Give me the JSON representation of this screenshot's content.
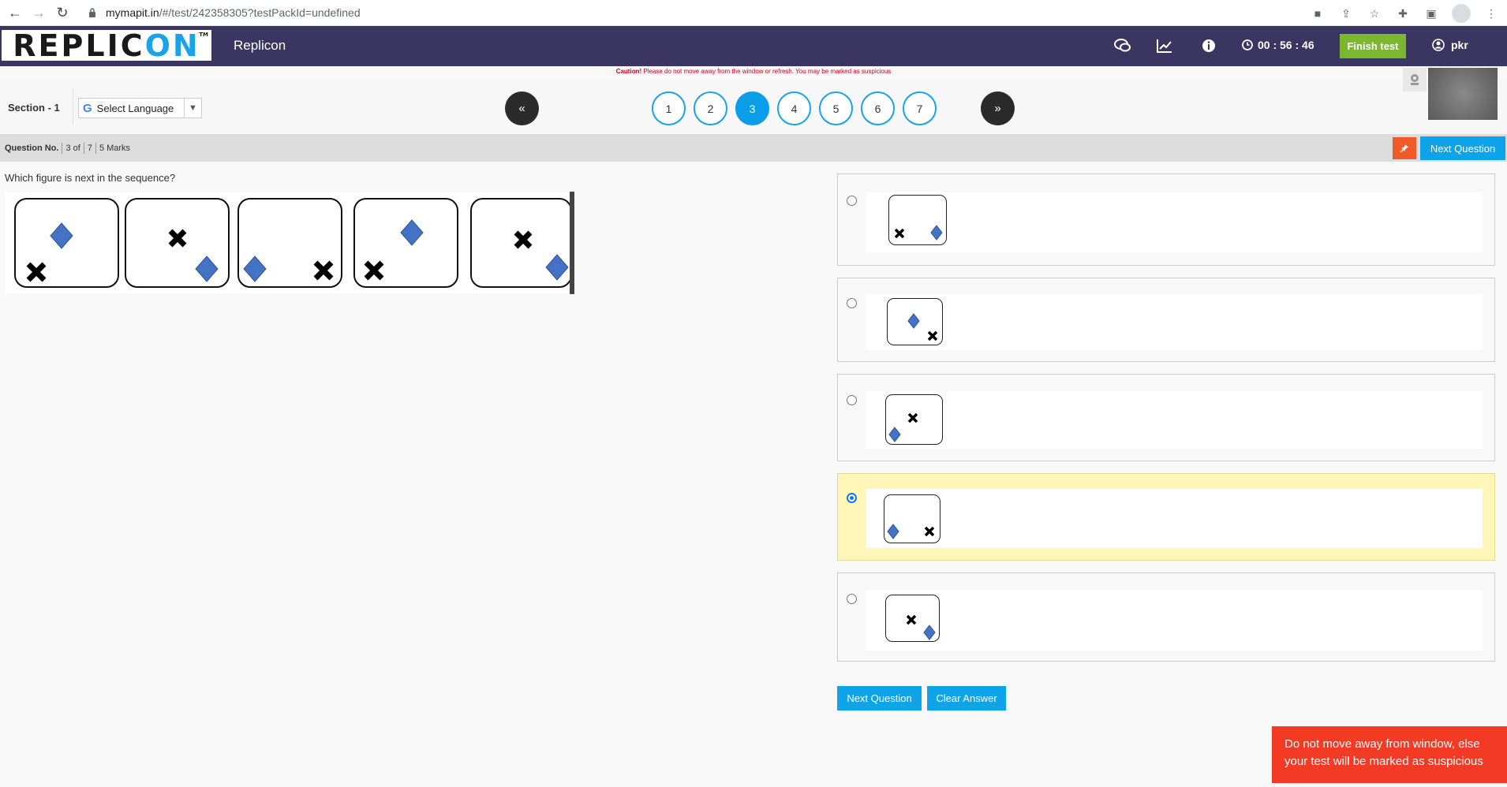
{
  "browser": {
    "url_host": "mymapit.in",
    "url_path": "/#/test/242358305?testPackId=undefined"
  },
  "header": {
    "logo_text_a": "REPLIC",
    "logo_text_b": "ON",
    "logo_tm": "TM",
    "app_name": "Replicon",
    "timer": "00 : 56 : 46",
    "finish_label": "Finish test",
    "user_name": "pkr"
  },
  "caution": {
    "bold": "Caution!",
    "text": " Please do not move away from the window or refresh. You may be marked as suspicious"
  },
  "section": {
    "label": "Section - 1",
    "language_label": "Select Language",
    "prev_label": "«",
    "next_label": "»",
    "pages": [
      "1",
      "2",
      "3",
      "4",
      "5",
      "6",
      "7"
    ],
    "current_page": "3"
  },
  "question_bar": {
    "label": "Question No.",
    "current": "3 of",
    "total": "7",
    "marks": "5 Marks",
    "next_label": "Next Question"
  },
  "question": {
    "text": "Which figure is next in the sequence?"
  },
  "options": {
    "selected_index": 3
  },
  "actions": {
    "next_label": "Next Question",
    "clear_label": "Clear Answer"
  },
  "toast": {
    "text": "Do not move away from window, else your test will be marked as suspicious"
  },
  "colors": {
    "header_bg": "#3a3561",
    "accent_blue": "#0fa4e9",
    "finish_green": "#7cb82f",
    "warning_red": "#f23a25",
    "diamond_blue": "#4472c4",
    "selected_option_bg": "#fdf6b8"
  }
}
